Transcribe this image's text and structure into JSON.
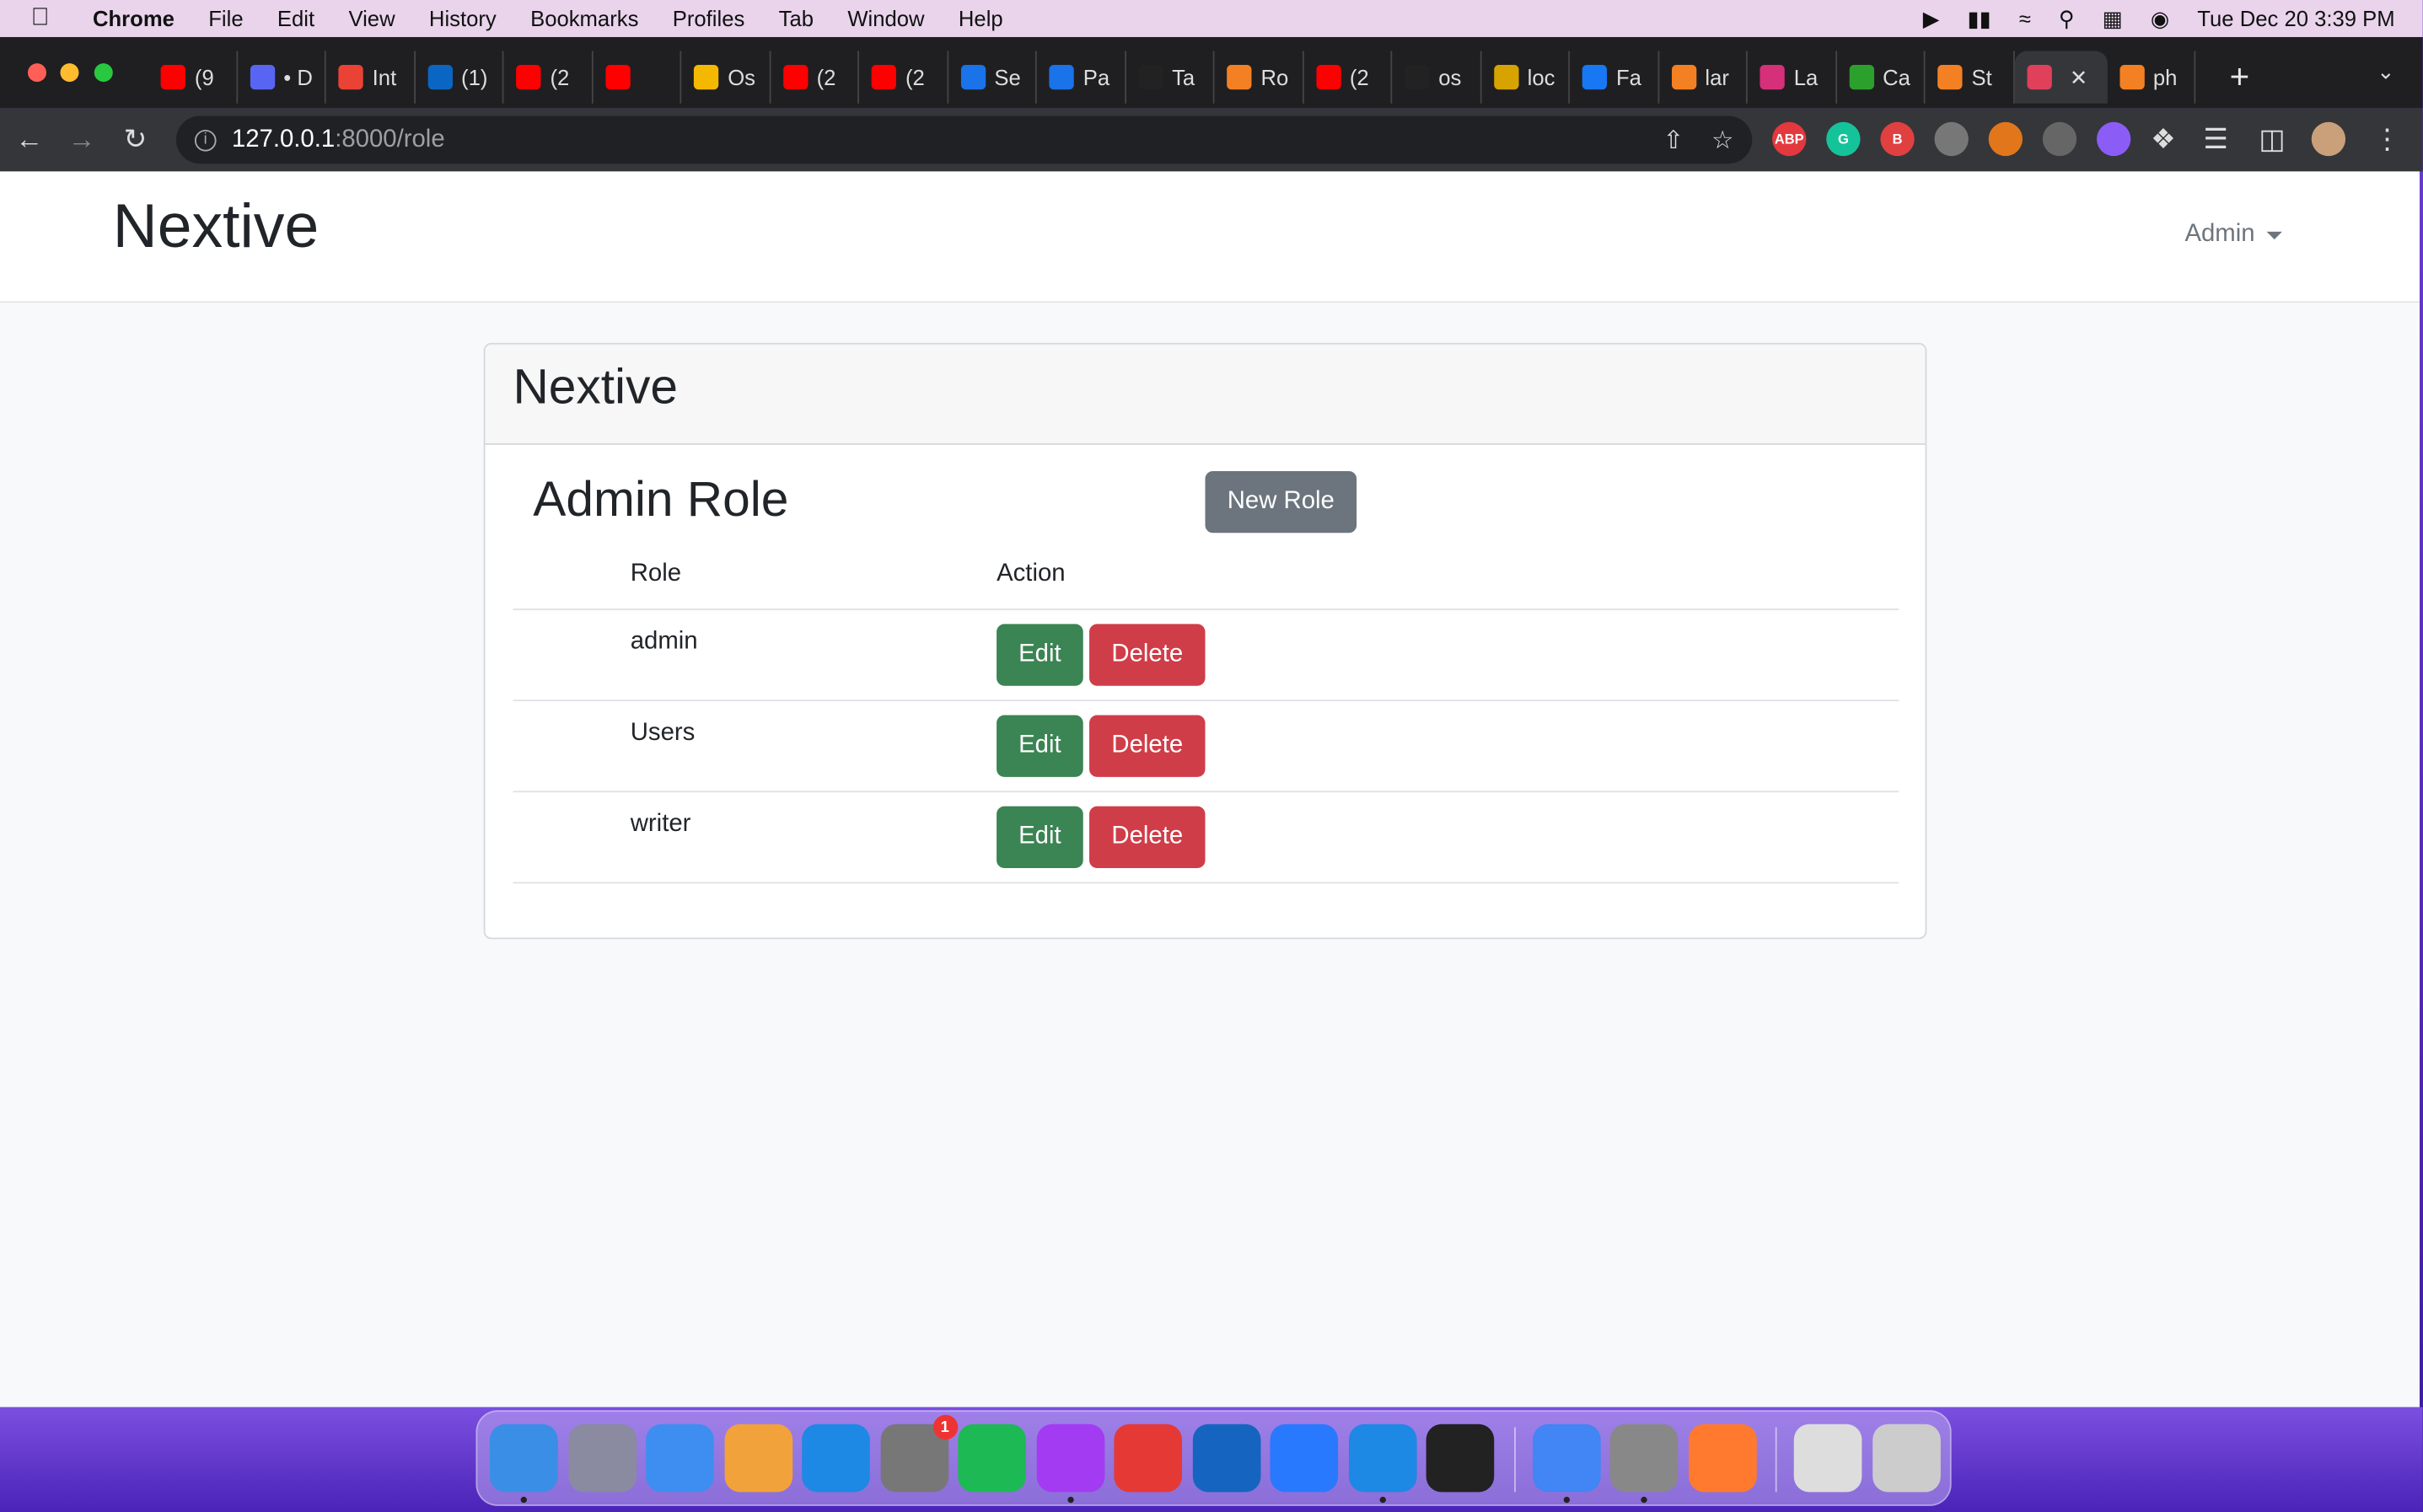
{
  "menubar": {
    "app": "Chrome",
    "items": [
      "File",
      "Edit",
      "View",
      "History",
      "Bookmarks",
      "Profiles",
      "Tab",
      "Window",
      "Help"
    ],
    "clock": "Tue Dec 20  3:39 PM"
  },
  "browser": {
    "tabs": [
      {
        "label": "(9",
        "icon": "youtube-icon",
        "color": "#ff0000"
      },
      {
        "label": "• D",
        "icon": "discord-icon",
        "color": "#5865f2"
      },
      {
        "label": "Int",
        "icon": "gmail-icon",
        "color": "#ea4335"
      },
      {
        "label": "(1)",
        "icon": "linkedin-icon",
        "color": "#0a66c2"
      },
      {
        "label": "(2",
        "icon": "youtube-icon",
        "color": "#ff0000"
      },
      {
        "label": "",
        "icon": "youtube-icon",
        "color": "#ff0000"
      },
      {
        "label": "Os",
        "icon": "coin-icon",
        "color": "#f5b800"
      },
      {
        "label": "(2",
        "icon": "youtube-icon",
        "color": "#ff0000"
      },
      {
        "label": "(2",
        "icon": "youtube-icon",
        "color": "#ff0000"
      },
      {
        "label": "Se",
        "icon": "leaf-icon",
        "color": "#1a73e8"
      },
      {
        "label": "Pa",
        "icon": "leaf-icon",
        "color": "#1a73e8"
      },
      {
        "label": "Ta",
        "icon": "github-icon",
        "color": "#222222"
      },
      {
        "label": "Ro",
        "icon": "stackoverflow-icon",
        "color": "#f48024"
      },
      {
        "label": "(2",
        "icon": "youtube-icon",
        "color": "#ff0000"
      },
      {
        "label": "os",
        "icon": "github-icon",
        "color": "#222222"
      },
      {
        "label": "loc",
        "icon": "mountain-icon",
        "color": "#d6a300"
      },
      {
        "label": "Fa",
        "icon": "facebook-icon",
        "color": "#1877f2"
      },
      {
        "label": "lar",
        "icon": "stackoverflow-icon",
        "color": "#f48024"
      },
      {
        "label": "La",
        "icon": "app-icon",
        "color": "#d6307a"
      },
      {
        "label": "Ca",
        "icon": "refresh-icon",
        "color": "#2ca02c"
      },
      {
        "label": "St",
        "icon": "stackoverflow-icon",
        "color": "#f48024"
      },
      {
        "label": "",
        "icon": "active-tab-icon",
        "color": "#e0405a",
        "active": true
      },
      {
        "label": "ph",
        "icon": "stackoverflow-icon",
        "color": "#f48024"
      }
    ],
    "url_host": "127.0.0.1",
    "url_path": ":8000/role",
    "extensions": [
      {
        "name": "adblock-icon",
        "label": "ABP",
        "color": "#e3383d"
      },
      {
        "name": "grammarly-icon",
        "label": "G",
        "color": "#15c39a"
      },
      {
        "name": "ext-red-icon",
        "label": "B",
        "color": "#e04040"
      },
      {
        "name": "cloud-icon",
        "label": "",
        "color": "#777777"
      },
      {
        "name": "metamask-icon",
        "label": "",
        "color": "#e2761b"
      },
      {
        "name": "mail-ext-icon",
        "label": "",
        "color": "#666666"
      },
      {
        "name": "ext-purple-icon",
        "label": "",
        "color": "#8b5cf6"
      }
    ]
  },
  "navbar": {
    "brand": "Nextive",
    "user_menu": "Admin"
  },
  "card": {
    "header": "Nextive",
    "title": "Admin Role",
    "new_button": "New Role",
    "columns": [
      "Role",
      "Action"
    ],
    "rows": [
      {
        "role": "admin",
        "edit": "Edit",
        "delete": "Delete"
      },
      {
        "role": "Users",
        "edit": "Edit",
        "delete": "Delete"
      },
      {
        "role": "writer",
        "edit": "Edit",
        "delete": "Delete"
      }
    ]
  },
  "dock": {
    "apps": [
      {
        "name": "finder-icon",
        "color": "#3a8ee6",
        "running": true
      },
      {
        "name": "launchpad-icon",
        "color": "#8a8aa0",
        "running": false
      },
      {
        "name": "mail-icon",
        "color": "#3d8ef0",
        "running": false
      },
      {
        "name": "photos-icon",
        "color": "#f2a23a",
        "running": false
      },
      {
        "name": "app-store-icon",
        "color": "#1e88e5",
        "running": false
      },
      {
        "name": "system-prefs-icon",
        "color": "#777777",
        "running": false,
        "badge": "1"
      },
      {
        "name": "spotify-icon",
        "color": "#1db954",
        "running": false
      },
      {
        "name": "messenger-icon",
        "color": "#a33bf2",
        "running": true
      },
      {
        "name": "wps-icon",
        "color": "#e53935",
        "running": false
      },
      {
        "name": "ai-app-icon",
        "color": "#1565c0",
        "running": false
      },
      {
        "name": "xcode-icon",
        "color": "#2979ff",
        "running": false
      },
      {
        "name": "vscode-icon",
        "color": "#1e88e5",
        "running": true
      },
      {
        "name": "activity-monitor-icon",
        "color": "#222222",
        "running": false
      },
      {
        "name": "chrome-icon",
        "color": "#4285f4",
        "running": true
      },
      {
        "name": "settings-icon",
        "color": "#888888",
        "running": true
      },
      {
        "name": "pen-app-icon",
        "color": "#ff7a2f",
        "running": false
      },
      {
        "name": "photo-stack-icon",
        "color": "#dddddd",
        "running": false
      },
      {
        "name": "trash-icon",
        "color": "#cccccc",
        "running": false
      }
    ]
  }
}
